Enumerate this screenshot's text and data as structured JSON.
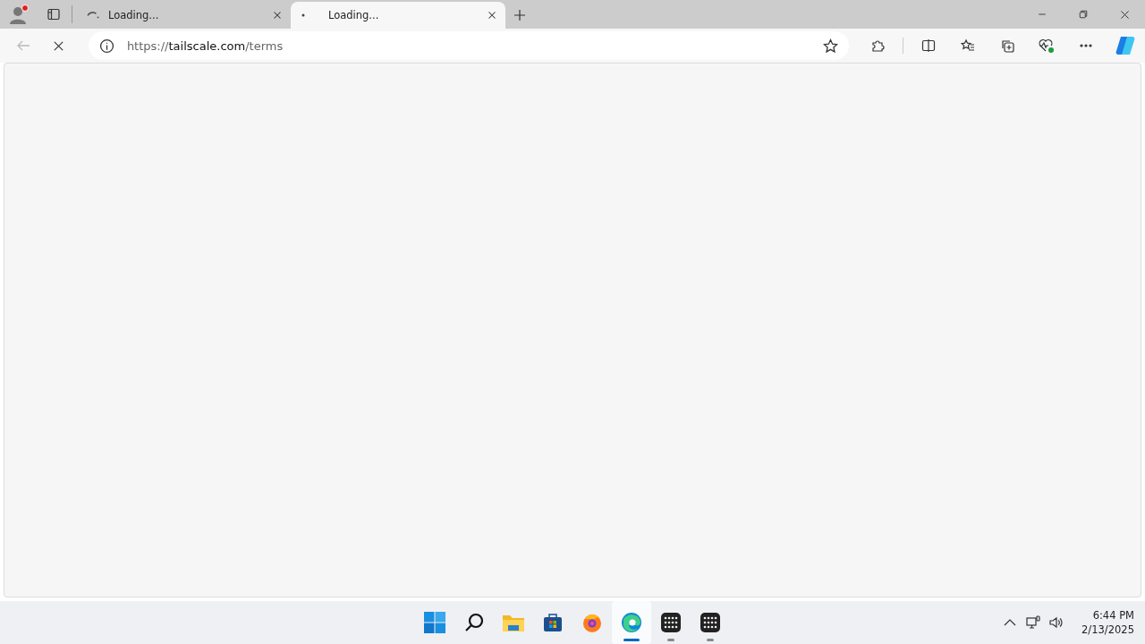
{
  "tabs": [
    {
      "title": "Loading...",
      "selected": false,
      "loading": true
    },
    {
      "title": "Loading...",
      "selected": true,
      "loading": false
    }
  ],
  "address_bar": {
    "scheme": "https://",
    "host": "tailscale.com",
    "path": "/terms"
  },
  "taskbar": {
    "apps": [
      {
        "kind": "start",
        "selected": false,
        "running": false
      },
      {
        "kind": "search",
        "selected": false,
        "running": false
      },
      {
        "kind": "files",
        "selected": false,
        "running": false
      },
      {
        "kind": "store",
        "selected": false,
        "running": false
      },
      {
        "kind": "firefox",
        "selected": false,
        "running": false
      },
      {
        "kind": "edge",
        "selected": true,
        "running": true
      },
      {
        "kind": "grid",
        "selected": false,
        "running": true
      },
      {
        "kind": "grid",
        "selected": false,
        "running": true
      }
    ],
    "time": "6:44 PM",
    "date": "2/13/2025"
  }
}
